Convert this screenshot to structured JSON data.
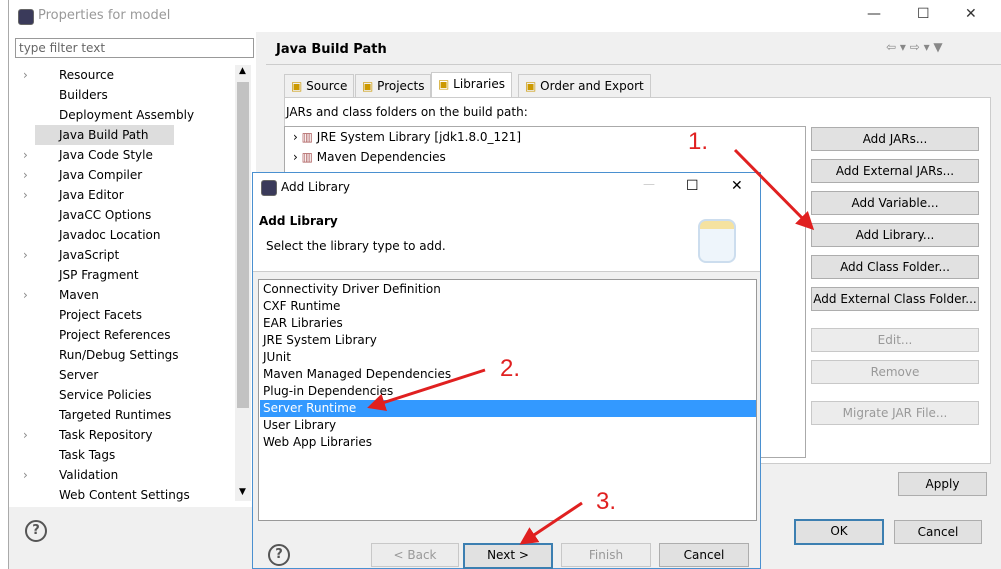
{
  "window": {
    "title": "Properties for model"
  },
  "filter": {
    "placeholder": "type filter text"
  },
  "tree": [
    {
      "label": "Resource",
      "expandable": true
    },
    {
      "label": "Builders",
      "expandable": false
    },
    {
      "label": "Deployment Assembly",
      "expandable": false
    },
    {
      "label": "Java Build Path",
      "expandable": false,
      "selected": true
    },
    {
      "label": "Java Code Style",
      "expandable": true
    },
    {
      "label": "Java Compiler",
      "expandable": true
    },
    {
      "label": "Java Editor",
      "expandable": true
    },
    {
      "label": "JavaCC Options",
      "expandable": false
    },
    {
      "label": "Javadoc Location",
      "expandable": false
    },
    {
      "label": "JavaScript",
      "expandable": true
    },
    {
      "label": "JSP Fragment",
      "expandable": false
    },
    {
      "label": "Maven",
      "expandable": true
    },
    {
      "label": "Project Facets",
      "expandable": false
    },
    {
      "label": "Project References",
      "expandable": false
    },
    {
      "label": "Run/Debug Settings",
      "expandable": false
    },
    {
      "label": "Server",
      "expandable": false
    },
    {
      "label": "Service Policies",
      "expandable": false
    },
    {
      "label": "Targeted Runtimes",
      "expandable": false
    },
    {
      "label": "Task Repository",
      "expandable": true
    },
    {
      "label": "Task Tags",
      "expandable": false
    },
    {
      "label": "Validation",
      "expandable": true
    },
    {
      "label": "Web Content Settings",
      "expandable": false
    }
  ],
  "page": {
    "title": "Java Build Path",
    "tabs": [
      "Source",
      "Projects",
      "Libraries",
      "Order and Export"
    ],
    "active_tab": "Libraries",
    "build_path_label": "JARs and class folders on the build path:",
    "entries": [
      "JRE System Library [jdk1.8.0_121]",
      "Maven Dependencies"
    ],
    "buttons": [
      {
        "label": "Add JARs...",
        "enabled": true
      },
      {
        "label": "Add External JARs...",
        "enabled": true
      },
      {
        "label": "Add Variable...",
        "enabled": true
      },
      {
        "label": "Add Library...",
        "enabled": true
      },
      {
        "label": "Add Class Folder...",
        "enabled": true
      },
      {
        "label": "Add External Class Folder...",
        "enabled": true
      },
      {
        "label": "Edit...",
        "enabled": false
      },
      {
        "label": "Remove",
        "enabled": false
      },
      {
        "label": "Migrate JAR File...",
        "enabled": false
      }
    ],
    "apply": "Apply",
    "ok": "OK",
    "cancel": "Cancel",
    "help": "?"
  },
  "dialog": {
    "title": "Add Library",
    "heading": "Add Library",
    "description": "Select the library type to add.",
    "items": [
      "Connectivity Driver Definition",
      "CXF Runtime",
      "EAR Libraries",
      "JRE System Library",
      "JUnit",
      "Maven Managed Dependencies",
      "Plug-in Dependencies",
      "Server Runtime",
      "User Library",
      "Web App Libraries"
    ],
    "selected": "Server Runtime",
    "back": "< Back",
    "next": "Next >",
    "finish": "Finish",
    "cancel": "Cancel",
    "help": "?"
  },
  "annotations": [
    "1.",
    "2.",
    "3."
  ],
  "colors": {
    "selection": "#3399ff",
    "annotation": "#e02020",
    "default_border": "#3c7fb1"
  }
}
